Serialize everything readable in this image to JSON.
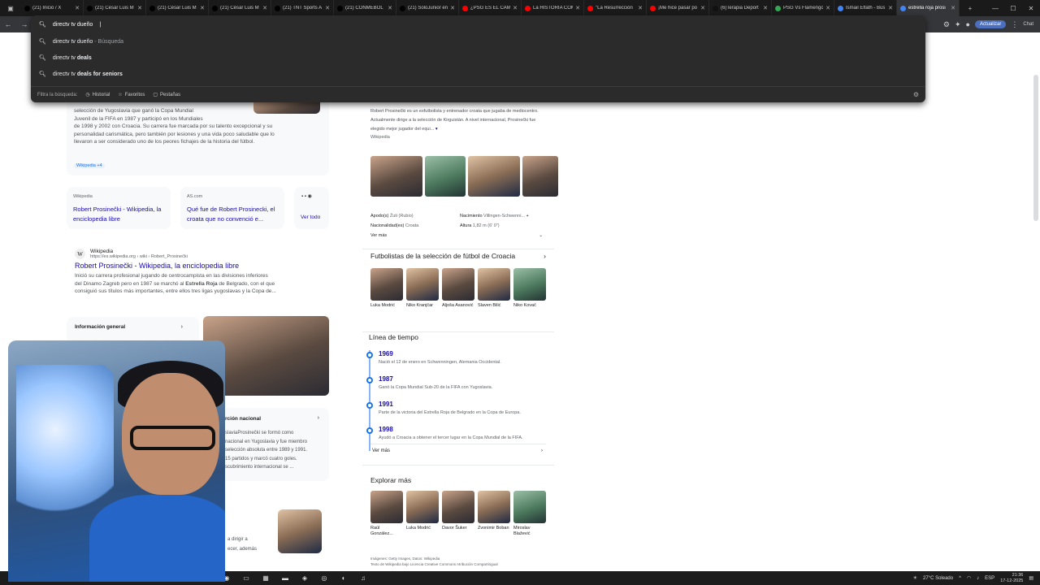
{
  "tabs": [
    {
      "label": "(21) Inicio / X",
      "color": "#000000"
    },
    {
      "label": "(21) César Luis M",
      "color": "#000000"
    },
    {
      "label": "(21) César Luis M",
      "color": "#000000"
    },
    {
      "label": "(21) César Luis M",
      "color": "#000000"
    },
    {
      "label": "(21) TNT Sports A",
      "color": "#000000"
    },
    {
      "label": "(21) CONMEBOL",
      "color": "#000000"
    },
    {
      "label": "(21) SoloJunior en",
      "color": "#000000"
    },
    {
      "label": "¿PSG ES EL CAMP",
      "color": "#ff0000"
    },
    {
      "label": "La HISTORIA COM",
      "color": "#ff0000"
    },
    {
      "label": "\"La Resurrección",
      "color": "#ff0000"
    },
    {
      "label": "¡Me hice pasar po",
      "color": "#ff0000"
    },
    {
      "label": "(6)Terapia Deport",
      "color": "#111111"
    },
    {
      "label": "PSG Vs Flamengo",
      "color": "#34a853"
    },
    {
      "label": "Ismail Elfath - Bús",
      "color": "#4285f4"
    },
    {
      "label": "estrella roja prosi",
      "color": "#4285f4"
    }
  ],
  "toolbar": {
    "update_label": "Actualizar",
    "chat_label": "Chat"
  },
  "omnibox": {
    "query": "directv tv dueño",
    "suggestions": [
      {
        "prefix": "directv tv dueño",
        "suffix": " - Búsqueda"
      },
      {
        "prefix": "directv tv ",
        "suffix": "deals"
      },
      {
        "prefix": "directv tv ",
        "suffix": "deals for seniors"
      }
    ],
    "filter_label": "Filtra la búsqueda:",
    "filters": [
      "Historial",
      "Favoritos",
      "Pestañas"
    ]
  },
  "page": {
    "overview_text_lines": [
      "selección de Yugoslavia que ganó la Copa Mundial",
      "Juvenil de la FIFA en 1987 y participó en los Mundiales",
      "de 1998 y 2002 con Croacia. Su carrera fue marcada por su talento excepcional y su",
      "personalidad carismática, pero también por lesiones y una vida poco saludable que lo",
      "llevaron a ser considerado uno de los peores fichajes de la historia del fútbol."
    ],
    "overview_source": "Wikipedia",
    "overview_more": "+4",
    "cards": [
      {
        "site": "Wikipedia",
        "title": "Robert Prosinečki - Wikipedia, la enciclopedia libre"
      },
      {
        "site": "AS.com",
        "title": "Qué fue de Robert Prosinecki, el croata que no convenció e..."
      }
    ],
    "see_all": "Ver todo",
    "result": {
      "site": "Wikipedia",
      "url": "https://es.wikipedia.org › wiki › Robert_Prosinečki",
      "title": "Robert Prosinečki - Wikipedia, la enciclopedia libre",
      "snippet_lines": [
        "Inició su carrera profesional jugando de centrocampista en las divisiones inferiores",
        "del Dinamo Zagreb pero en 1987 se marchó al Estrella Roja de Belgrado, con el que",
        "consiguió sus títulos más importantes, entre ellos tres ligas yugoslavas y la Copa de..."
      ],
      "bold": "Estrella Roja"
    },
    "info_general": "Información general",
    "national_title": "rción nacional",
    "national_lines": [
      "slaviaProsinečki se formó como",
      "nacional en Yugoslavia y fue miembro",
      "selección absoluta entre 1989 y 1991.",
      "15 partidos y marcó cuatro goles.",
      "scubrimiento internacional se ..."
    ],
    "bottom_lines": [
      "a dirigir a",
      "ecer, además"
    ]
  },
  "panel": {
    "desc": "Robert Prosinečki es un exfutbolista y entrenador croata que jugaba de mediocentro. Actualmente dirige a la selección de Kirguistán. A nivel internacional, Prosinečki fue elegido mejor jugador del equi...",
    "desc_source": "Wikipedia",
    "facts": [
      {
        "k": "Apodo(s)",
        "v": "Žuti (Rubio)"
      },
      {
        "k": "Nacimiento",
        "v": "Villingen-Schwenni..."
      },
      {
        "k": "Nacionalidad(es)",
        "v": "Croata"
      },
      {
        "k": "Altura",
        "v": "1,82 m (6′ 0″)"
      }
    ],
    "see_more": "Ver más",
    "players_title": "Futbolistas de la selección de fútbol de Croacia",
    "players": [
      "Luka Modrić",
      "Niko Kranjčar",
      "Aljoša Asanović",
      "Slaven Bilić",
      "Niko Kovač"
    ],
    "timeline_title": "Línea de tiempo",
    "timeline": [
      {
        "year": "1969",
        "desc": "Nació el 12 de enero en Schwenningen, Alemania Occidental."
      },
      {
        "year": "1987",
        "desc": "Ganó la Copa Mundial Sub-20 de la FIFA con Yugoslavia."
      },
      {
        "year": "1991",
        "desc": "Parte de la victoria del Estrella Roja de Belgrado en la Copa de Europa."
      },
      {
        "year": "1998",
        "desc": "Ayudó a Croacia a obtener el tercer lugar en la Copa Mundial de la FIFA."
      }
    ],
    "timeline_more": "Ver más",
    "explore_title": "Explorar más",
    "explore": [
      "Raúl González...",
      "Luka Modrić",
      "Davor Šuker",
      "Zvonimir Boban",
      "Miroslav Blažević"
    ],
    "credits_1": "Imágenes: Getty Images, Datos: Wikipedia",
    "credits_2": "Texto de Wikipedia bajo Licencia Creative Commons Atribución Compartirigual"
  },
  "taskbar": {
    "weather": "27°C  Soleado",
    "lang": "ESP",
    "time": "21:36",
    "date": "17-12-2025"
  }
}
